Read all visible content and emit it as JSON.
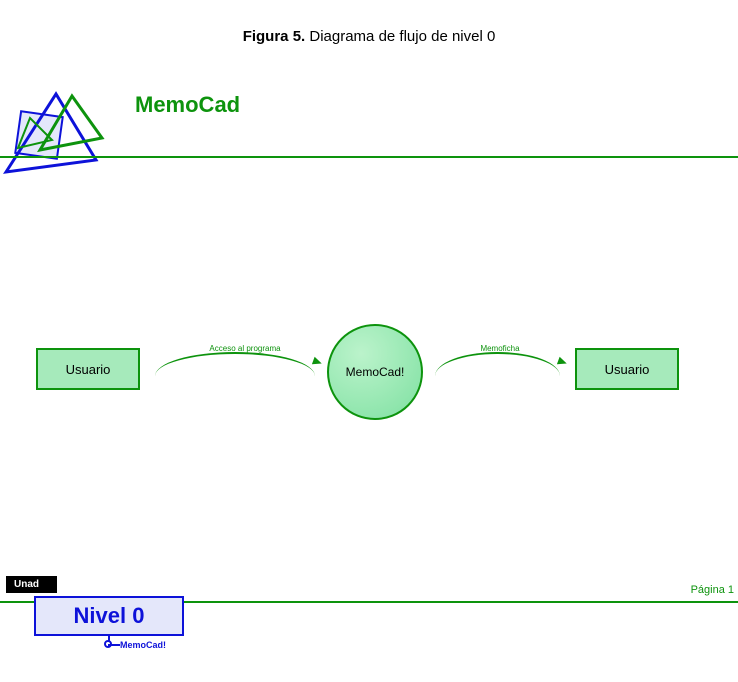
{
  "caption": {
    "figure_label": "Figura 5.",
    "figure_text": " Diagrama de flujo de nivel 0"
  },
  "header": {
    "title": "MemoCad"
  },
  "diagram": {
    "entity_left": "Usuario",
    "process": "MemoCad!",
    "entity_right": "Usuario",
    "flow1": "Acceso al programa",
    "flow2": "Memoficha"
  },
  "footer": {
    "badge": "Unad",
    "level_label": "Nivel 0",
    "subsystem": "MemoCad!",
    "page": "Página 1"
  },
  "colors": {
    "green": "#0D930D",
    "blue": "#0D12D9",
    "entity_fill": "#A6EABB"
  }
}
